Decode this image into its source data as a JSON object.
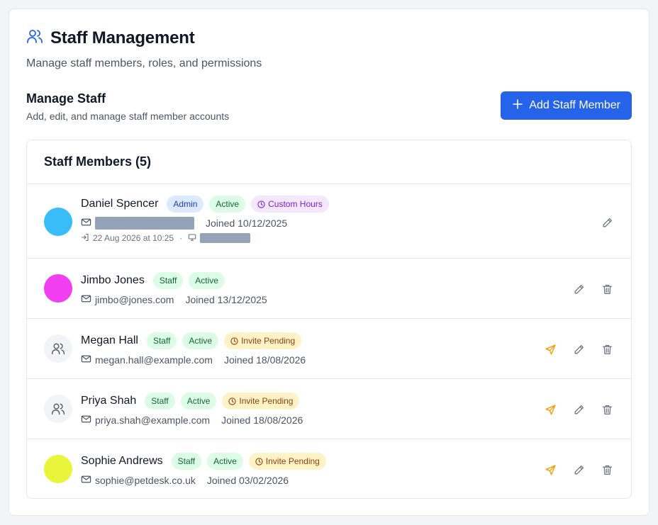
{
  "header": {
    "title": "Staff Management",
    "subtitle": "Manage staff members, roles, and permissions"
  },
  "section": {
    "title": "Manage Staff",
    "description": "Add, edit, and manage staff member accounts",
    "add_button_label": "Add Staff Member"
  },
  "list": {
    "title": "Staff Members (5)",
    "members": [
      {
        "name": "Daniel Spencer",
        "badges": [
          "Admin",
          "Active",
          "Custom Hours"
        ],
        "email": "",
        "joined": "Joined 10/12/2025",
        "last_login": "22 Aug 2026 at 10:25",
        "avatar_color": "#38bdf8"
      },
      {
        "name": "Jimbo Jones",
        "badges": [
          "Staff",
          "Active"
        ],
        "email": "jimbo@jones.com",
        "joined": "Joined 13/12/2025",
        "avatar_color": "#f03ef0"
      },
      {
        "name": "Megan Hall",
        "badges": [
          "Staff",
          "Active",
          "Invite Pending"
        ],
        "email": "megan.hall@example.com",
        "joined": "Joined 18/08/2026",
        "avatar_color": "#f3f4f6"
      },
      {
        "name": "Priya Shah",
        "badges": [
          "Staff",
          "Active",
          "Invite Pending"
        ],
        "email": "priya.shah@example.com",
        "joined": "Joined 18/08/2026",
        "avatar_color": "#f3f4f6"
      },
      {
        "name": "Sophie Andrews",
        "badges": [
          "Staff",
          "Active",
          "Invite Pending"
        ],
        "email": "sophie@petdesk.co.uk",
        "joined": "Joined 03/02/2026",
        "avatar_color": "#e8f53a"
      }
    ]
  },
  "icons": {
    "header": "users-icon",
    "add": "plus-icon",
    "email": "mail-icon",
    "login": "log-in-icon",
    "device": "monitor-icon",
    "clock": "clock-icon",
    "resend": "send-icon",
    "edit": "pencil-icon",
    "delete": "trash-icon"
  },
  "colors": {
    "primary": "#2563eb",
    "resend": "#f59e0b",
    "header_icon": "#2563eb"
  }
}
